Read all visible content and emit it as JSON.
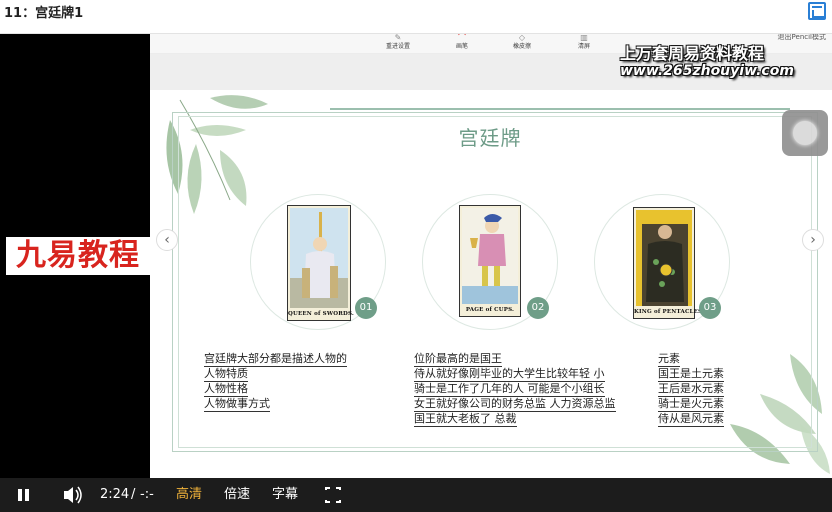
{
  "window": {
    "title": "11：宫廷牌1"
  },
  "left_panel": {
    "brand": "九易教程"
  },
  "toolbar": {
    "items": [
      {
        "label": "重进设置",
        "icon": "pen-icon"
      },
      {
        "label": "画笔",
        "icon": "brush-icon"
      },
      {
        "label": "橡皮擦",
        "icon": "eraser-icon"
      },
      {
        "label": "清屏",
        "icon": "clear-icon"
      }
    ],
    "exit_label": "退出Pencil模式"
  },
  "watermark": {
    "line1": "上万套周易资料教程",
    "line2": "www.265zhouyiw.com"
  },
  "slide": {
    "title": "宫廷牌",
    "cards": [
      {
        "number": "01",
        "caption": "QUEEN of SWORDS."
      },
      {
        "number": "02",
        "caption": "PAGE of CUPS."
      },
      {
        "number": "03",
        "caption": "KING of PENTACLES."
      }
    ],
    "text_left": [
      "宫廷牌大部分都是描述人物的",
      "人物特质",
      "人物性格",
      "人物做事方式"
    ],
    "text_middle": [
      "位阶最高的是国王",
      "侍从就好像刚毕业的大学生比较年轻 小",
      "骑士是工作了几年的人 可能是个小组长",
      "女王就好像公司的财务总监 人力资源总监",
      "国王就大老板了 总裁"
    ],
    "text_right": [
      "元素",
      "国王是土元素",
      "王后是水元素",
      "骑士是火元素",
      "侍从是风元素"
    ]
  },
  "player": {
    "time_current": "2:24",
    "time_separator": "/",
    "time_total": "-:-",
    "quality_label": "高清",
    "speed_label": "倍速",
    "subtitle_label": "字幕",
    "colors": {
      "active": "#f0b23a",
      "bar": "#1c1c1c"
    }
  },
  "colors": {
    "accent": "#6f9e88",
    "brand_red": "#d8241e",
    "title_green": "#6d9b87"
  }
}
